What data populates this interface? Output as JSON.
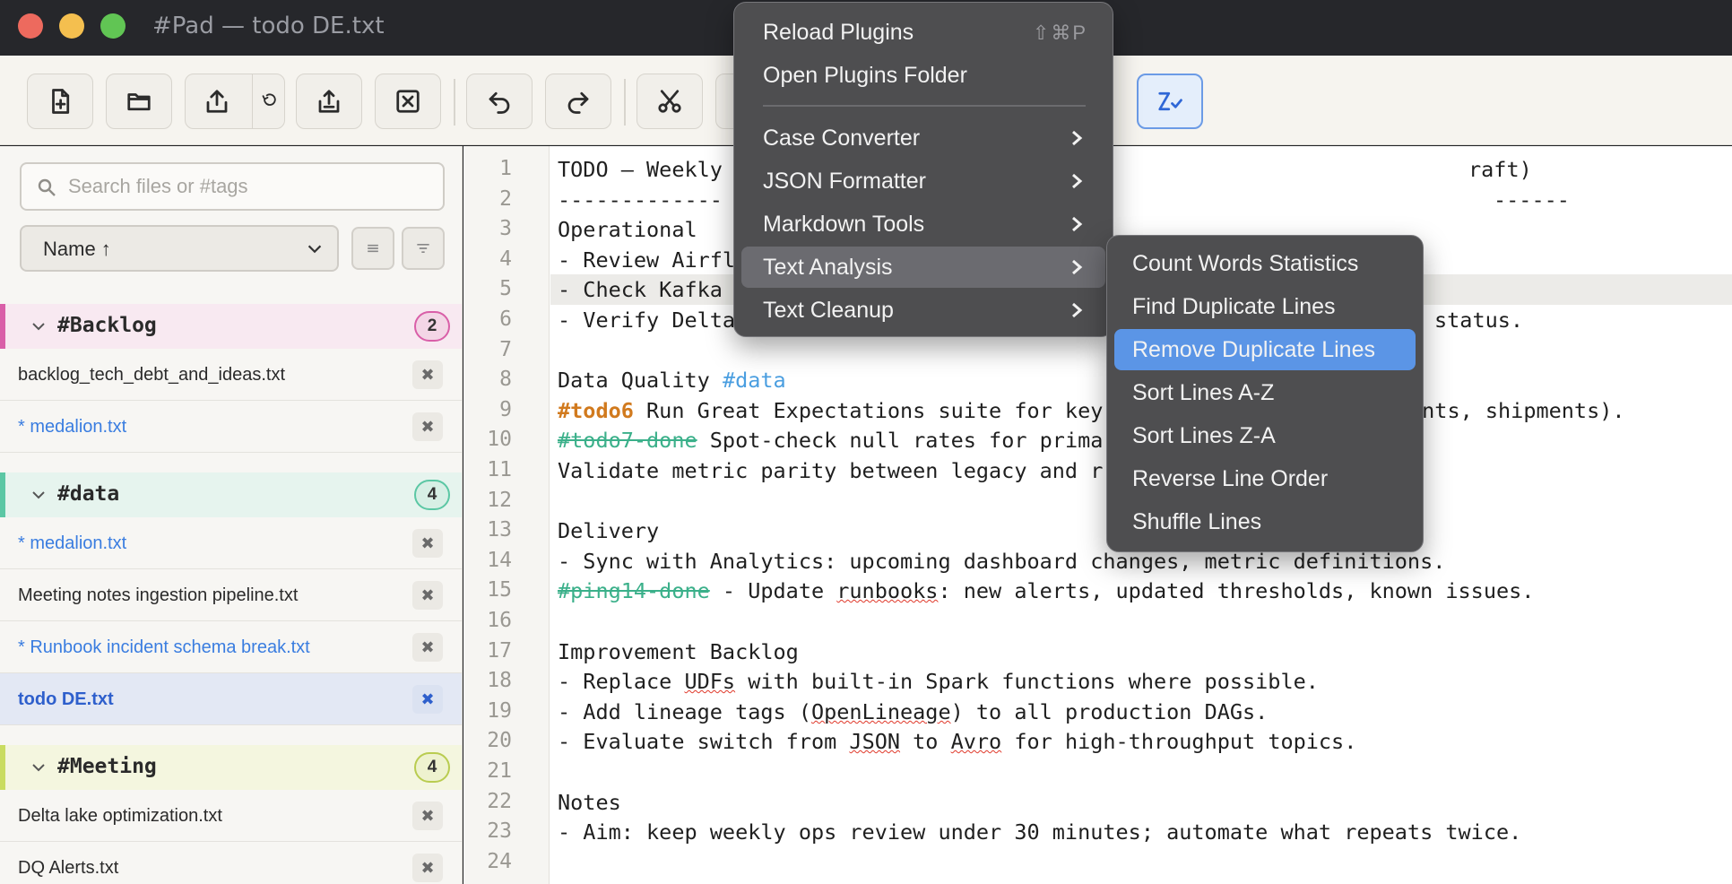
{
  "window": {
    "title": "#Pad — todo DE.txt"
  },
  "toolbar": {
    "buttons": [
      "new-file",
      "open-folder",
      "export",
      "export-version",
      "share",
      "close-file",
      "undo",
      "redo",
      "cut",
      "spell-check"
    ]
  },
  "sidebar": {
    "search_placeholder": "Search files or #tags",
    "sort_label": "Name ↑",
    "groups": [
      {
        "name": "#Backlog",
        "count": "2",
        "color": "#d95fa8",
        "files": [
          {
            "name": "backlog_tech_debt_and_ideas.txt",
            "modified": false
          },
          {
            "name": "* medalion.txt",
            "modified": true
          }
        ]
      },
      {
        "name": "#data",
        "count": "4",
        "color": "#5bc7a4",
        "files": [
          {
            "name": "* medalion.txt",
            "modified": true
          },
          {
            "name": "Meeting notes ingestion pipeline.txt",
            "modified": false
          },
          {
            "name": "* Runbook incident schema break.txt",
            "modified": true
          },
          {
            "name": "todo DE.txt",
            "modified": false,
            "selected": true
          }
        ]
      },
      {
        "name": "#Meeting",
        "count": "4",
        "color": "#c9dc60",
        "files": [
          {
            "name": "Delta lake optimization.txt",
            "modified": false
          },
          {
            "name": "DQ Alerts.txt",
            "modified": false
          }
        ]
      }
    ],
    "close_glyph": "✖"
  },
  "editor": {
    "line_numbers": [
      "1",
      "2",
      "3",
      "4",
      "5",
      "6",
      "7",
      "8",
      "9",
      "10",
      "11",
      "12",
      "13",
      "14",
      "15",
      "16",
      "17",
      "18",
      "19",
      "20",
      "21",
      "22",
      "23",
      "24"
    ],
    "lines": {
      "l1a": "TODO — Weekly",
      "l1b": "raft)",
      "l2a": "-------------",
      "l2b": "------",
      "l3": "Operational",
      "l4": "- Review Airfl",
      "l5": "- Check Kafka",
      "l6a": "- Verify Delta",
      "l6b": "status.",
      "l8a": "Data Quality ",
      "l8b": "#data",
      "l9a": "#todo6",
      "l9b": " Run Great Expectations suite for key",
      "l9c": "ents, shipments).",
      "l10a": "#todo7-done",
      "l10b": " Spot-check null rates for prima",
      "l11": "Validate metric parity between legacy and r",
      "l13": "Delivery",
      "l14": "- Sync with Analytics: upcoming dashboard changes, metric definitions.",
      "l15a": "#ping14-done",
      "l15b": " - Update ",
      "l15c": "runbooks",
      "l15d": ": new alerts, updated thresholds, known issues.",
      "l17": "Improvement Backlog",
      "l18a": "- Replace ",
      "l18b": "UDFs",
      "l18c": " with built-in Spark functions where possible.",
      "l19a": "- Add lineage tags (",
      "l19b": "OpenLineage",
      "l19c": ") to all production DAGs.",
      "l20a": "- Evaluate switch from ",
      "l20b": "JSON",
      "l20c": " to ",
      "l20d": "Avro",
      "l20e": " for high-throughput topics.",
      "l22": "Notes",
      "l23": "- Aim: keep weekly ops review under 30 minutes; automate what repeats twice."
    }
  },
  "plugins_menu": {
    "items": [
      {
        "label": "Reload Plugins",
        "shortcut": "⇧⌘P"
      },
      {
        "label": "Open Plugins Folder"
      },
      {
        "label": "Case Converter",
        "submenu": true
      },
      {
        "label": "JSON Formatter",
        "submenu": true
      },
      {
        "label": "Markdown Tools",
        "submenu": true
      },
      {
        "label": "Text Analysis",
        "submenu": true,
        "highlighted": true
      },
      {
        "label": "Text Cleanup",
        "submenu": true
      }
    ]
  },
  "text_analysis_submenu": {
    "items": [
      {
        "label": "Count Words  Statistics"
      },
      {
        "label": "Find Duplicate Lines"
      },
      {
        "label": "Remove Duplicate Lines",
        "selected": true
      },
      {
        "label": "Sort Lines A-Z"
      },
      {
        "label": "Sort Lines Z-A"
      },
      {
        "label": "Reverse Line Order"
      },
      {
        "label": "Shuffle Lines"
      }
    ]
  },
  "colors": {
    "accent": "#5b95e6",
    "tag_blue": "#4a9ee0",
    "tag_orange": "#d17a1e",
    "tag_done": "#3bb08a"
  }
}
